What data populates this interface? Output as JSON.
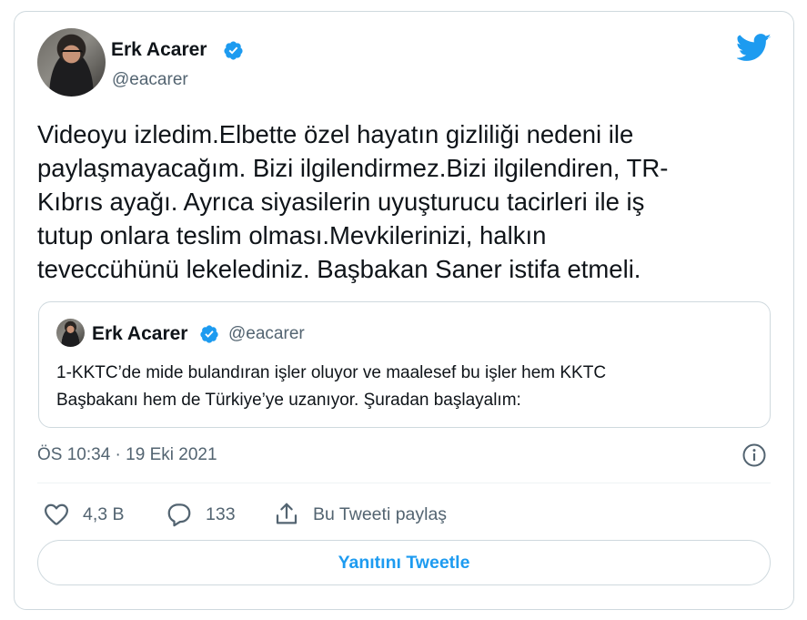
{
  "colors": {
    "accent": "#1d9bf0",
    "text_primary": "#0f1419",
    "text_secondary": "#536471",
    "border": "#cfd9de"
  },
  "tweet": {
    "author_name": "Erk Acarer",
    "handle": "@eacarer",
    "text": "Videoyu izledim.Elbette özel hayatın gizliliği nedeni ile\npaylaşmayacağım. Bizi ilgilendirmez.Bizi ilgilendiren, TR-\nKıbrıs ayağı. Ayrıca siyasilerin uyuşturucu tacirleri ile iş\ntutup onlara teslim olması.Mevkilerinizi, halkın\nteveccühünü lekelediniz. Başbakan Saner istifa etmeli.",
    "timestamp": "ÖS 10:34 · 19 Eki 2021"
  },
  "quoted_tweet": {
    "author_name": "Erk Acarer",
    "handle": "@eacarer",
    "text": "1-KKTC’de mide bulandıran işler oluyor ve maalesef bu işler hem KKTC\nBaşbakanı hem de Türkiye’ye uzanıyor. Şuradan başlayalım:"
  },
  "actions": {
    "like_count": "4,3 B",
    "reply_count": "133",
    "share_label": "Bu Tweeti paylaş"
  },
  "reply_button_label": "Yanıtını Tweetle",
  "icons": [
    "verified-badge-icon",
    "twitter-bird-icon",
    "info-icon",
    "heart-icon",
    "reply-bubble-icon",
    "share-icon"
  ]
}
